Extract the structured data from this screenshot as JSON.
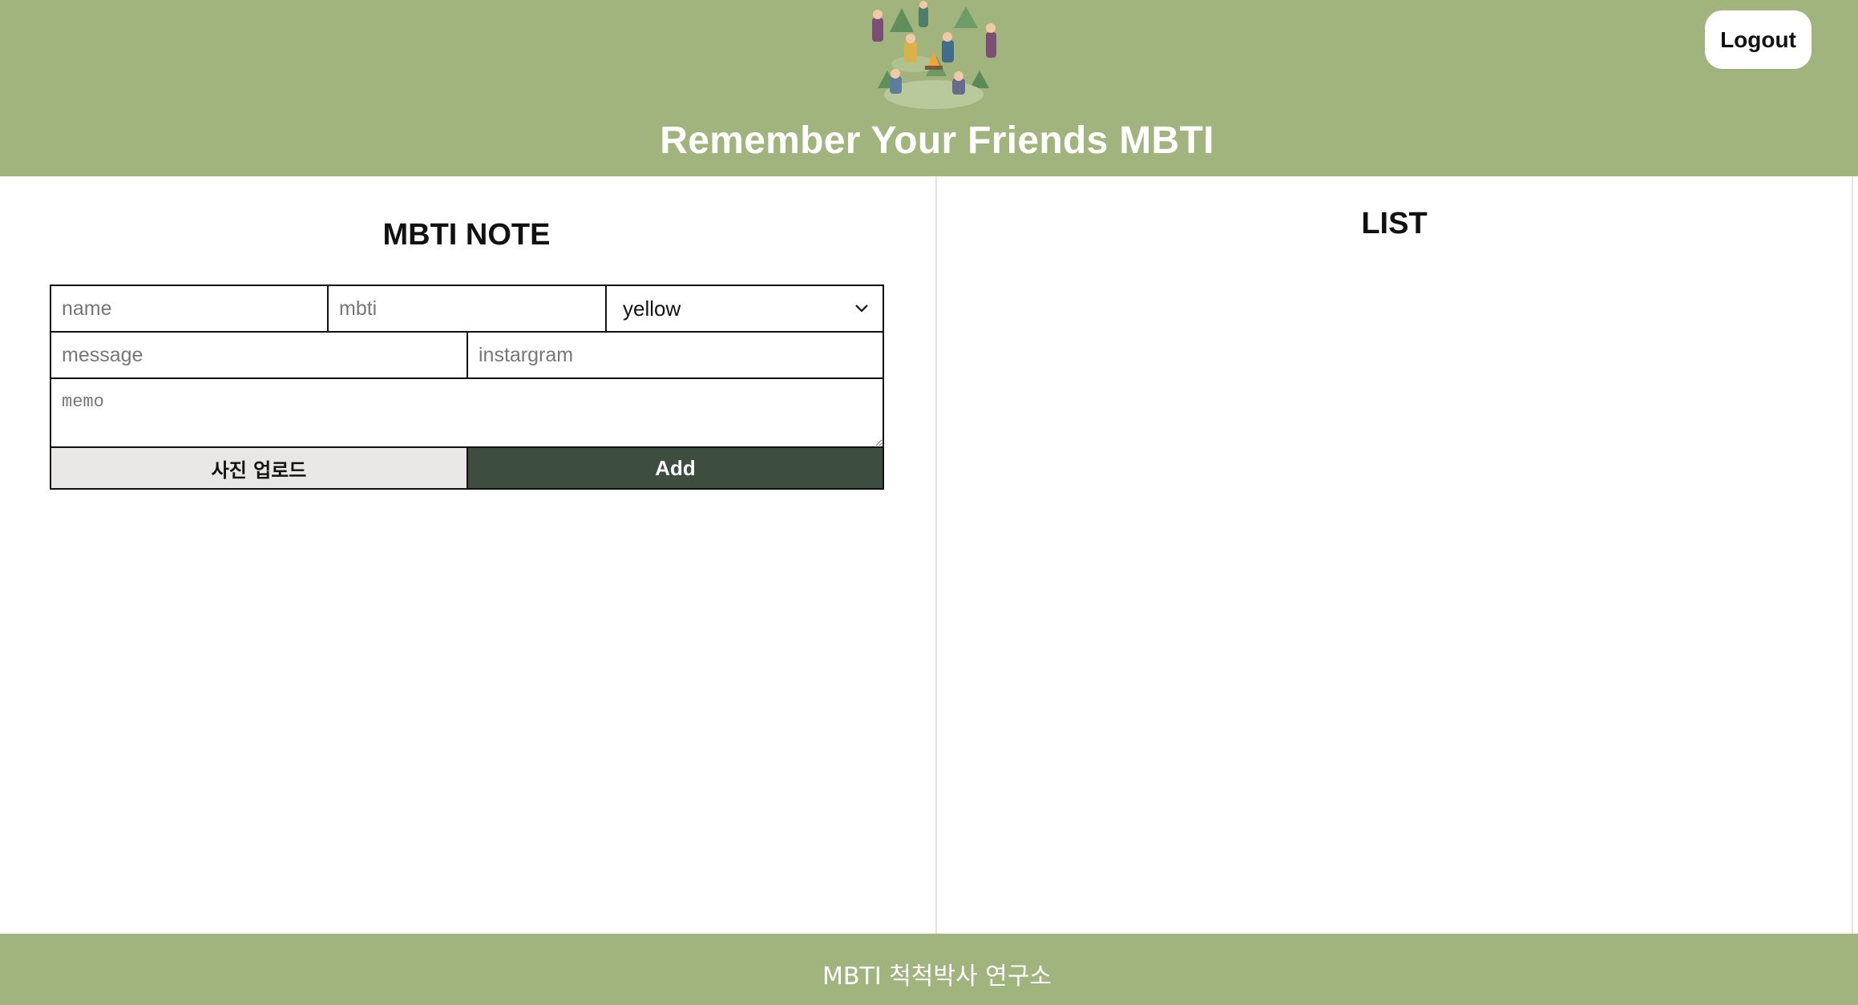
{
  "header": {
    "title": "Remember Your Friends MBTI",
    "logout_label": "Logout",
    "logo_icon": "friends-illustration-logo"
  },
  "note": {
    "title": "MBTI NOTE",
    "name_placeholder": "name",
    "mbti_placeholder": "mbti",
    "color_selected": "yellow",
    "message_placeholder": "message",
    "instagram_placeholder": "instargram",
    "memo_placeholder": "memo",
    "upload_label": "사진 업로드",
    "add_label": "Add"
  },
  "list": {
    "title": "LIST"
  },
  "footer": {
    "text": "MBTI 척척박사 연구소"
  },
  "colors": {
    "brand_green": "#a2b47d",
    "add_button": "#3d4d40",
    "upload_button": "#e9e7e6"
  }
}
